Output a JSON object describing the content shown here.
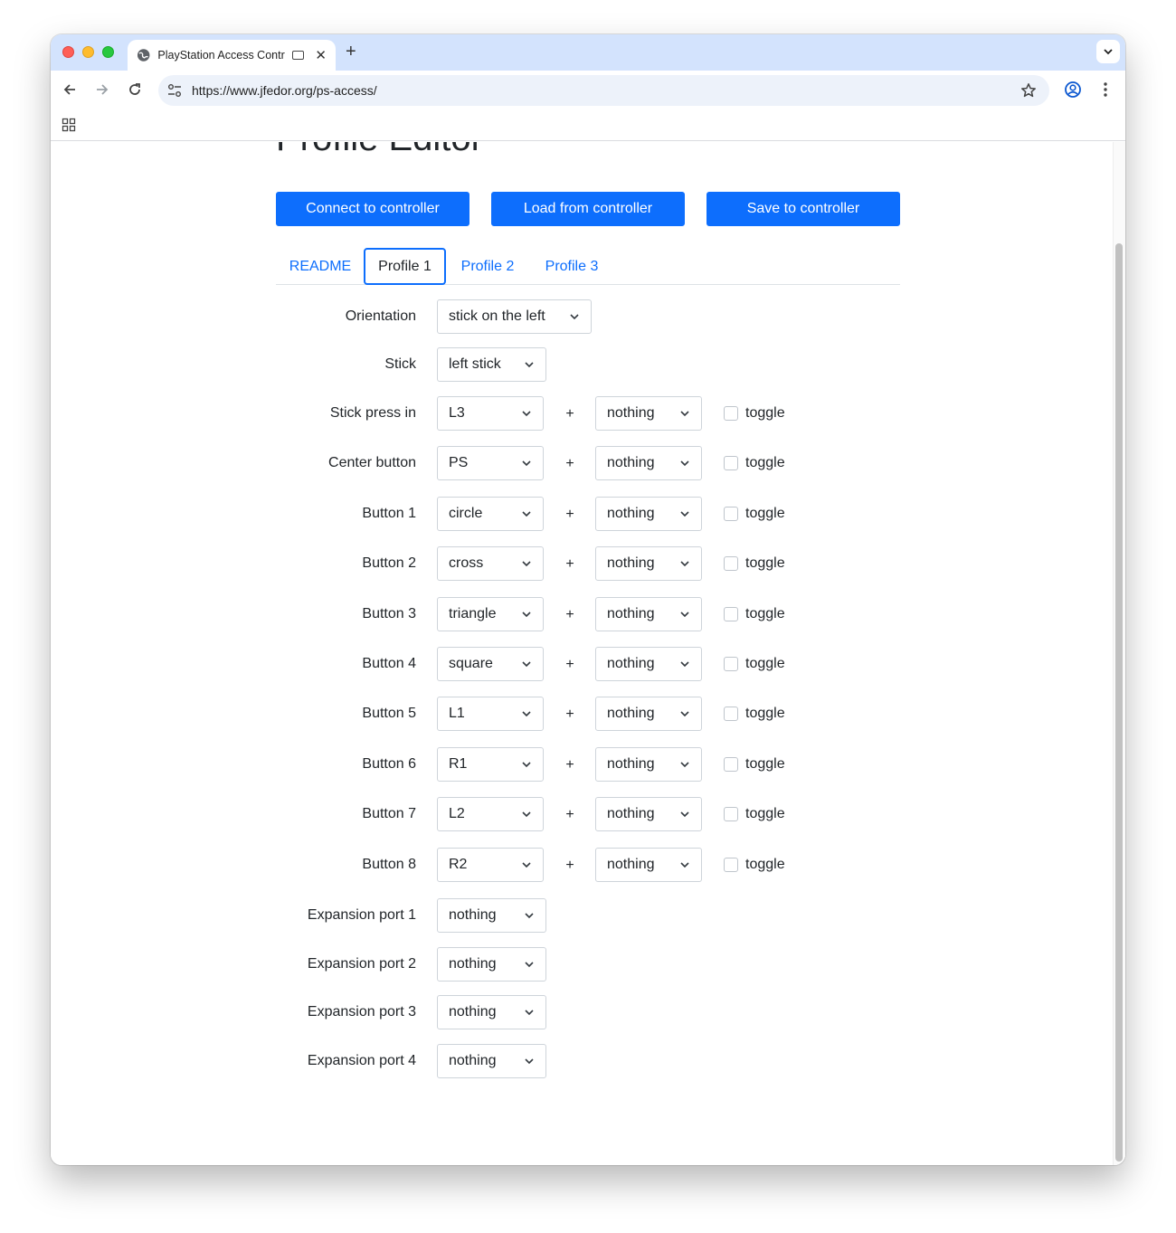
{
  "browser": {
    "tab_title": "PlayStation Access Contr",
    "url": "https://www.jfedor.org/ps-access/"
  },
  "page": {
    "title": "Profile Editor",
    "buttons": {
      "connect": "Connect to controller",
      "load": "Load from controller",
      "save": "Save to controller"
    },
    "tabs": [
      "README",
      "Profile 1",
      "Profile 2",
      "Profile 3"
    ],
    "active_tab": "Profile 1",
    "orientation": {
      "label": "Orientation",
      "value": "stick on the left"
    },
    "stick": {
      "label": "Stick",
      "value": "left stick"
    },
    "plus_sign": "+",
    "toggle_label": "toggle",
    "mappings": [
      {
        "label": "Stick press in",
        "value": "L3",
        "combo": "nothing",
        "toggle": false
      },
      {
        "label": "Center button",
        "value": "PS",
        "combo": "nothing",
        "toggle": false
      },
      {
        "label": "Button 1",
        "value": "circle",
        "combo": "nothing",
        "toggle": false
      },
      {
        "label": "Button 2",
        "value": "cross",
        "combo": "nothing",
        "toggle": false
      },
      {
        "label": "Button 3",
        "value": "triangle",
        "combo": "nothing",
        "toggle": false
      },
      {
        "label": "Button 4",
        "value": "square",
        "combo": "nothing",
        "toggle": false
      },
      {
        "label": "Button 5",
        "value": "L1",
        "combo": "nothing",
        "toggle": false
      },
      {
        "label": "Button 6",
        "value": "R1",
        "combo": "nothing",
        "toggle": false
      },
      {
        "label": "Button 7",
        "value": "L2",
        "combo": "nothing",
        "toggle": false
      },
      {
        "label": "Button 8",
        "value": "R2",
        "combo": "nothing",
        "toggle": false
      }
    ],
    "expansion_ports": [
      {
        "label": "Expansion port 1",
        "value": "nothing"
      },
      {
        "label": "Expansion port 2",
        "value": "nothing"
      },
      {
        "label": "Expansion port 3",
        "value": "nothing"
      },
      {
        "label": "Expansion port 4",
        "value": "nothing"
      }
    ]
  },
  "colors": {
    "primary": "#0d6efd",
    "tabstrip": "#d3e3fd",
    "omnibox": "#edf2fa"
  },
  "icons": [
    "globe-icon",
    "media-icon",
    "close-icon",
    "plus-icon",
    "chevron-down-icon",
    "back-icon",
    "forward-icon",
    "reload-icon",
    "tune-icon",
    "star-icon",
    "profile-icon",
    "menu-icon",
    "apps-icon"
  ]
}
